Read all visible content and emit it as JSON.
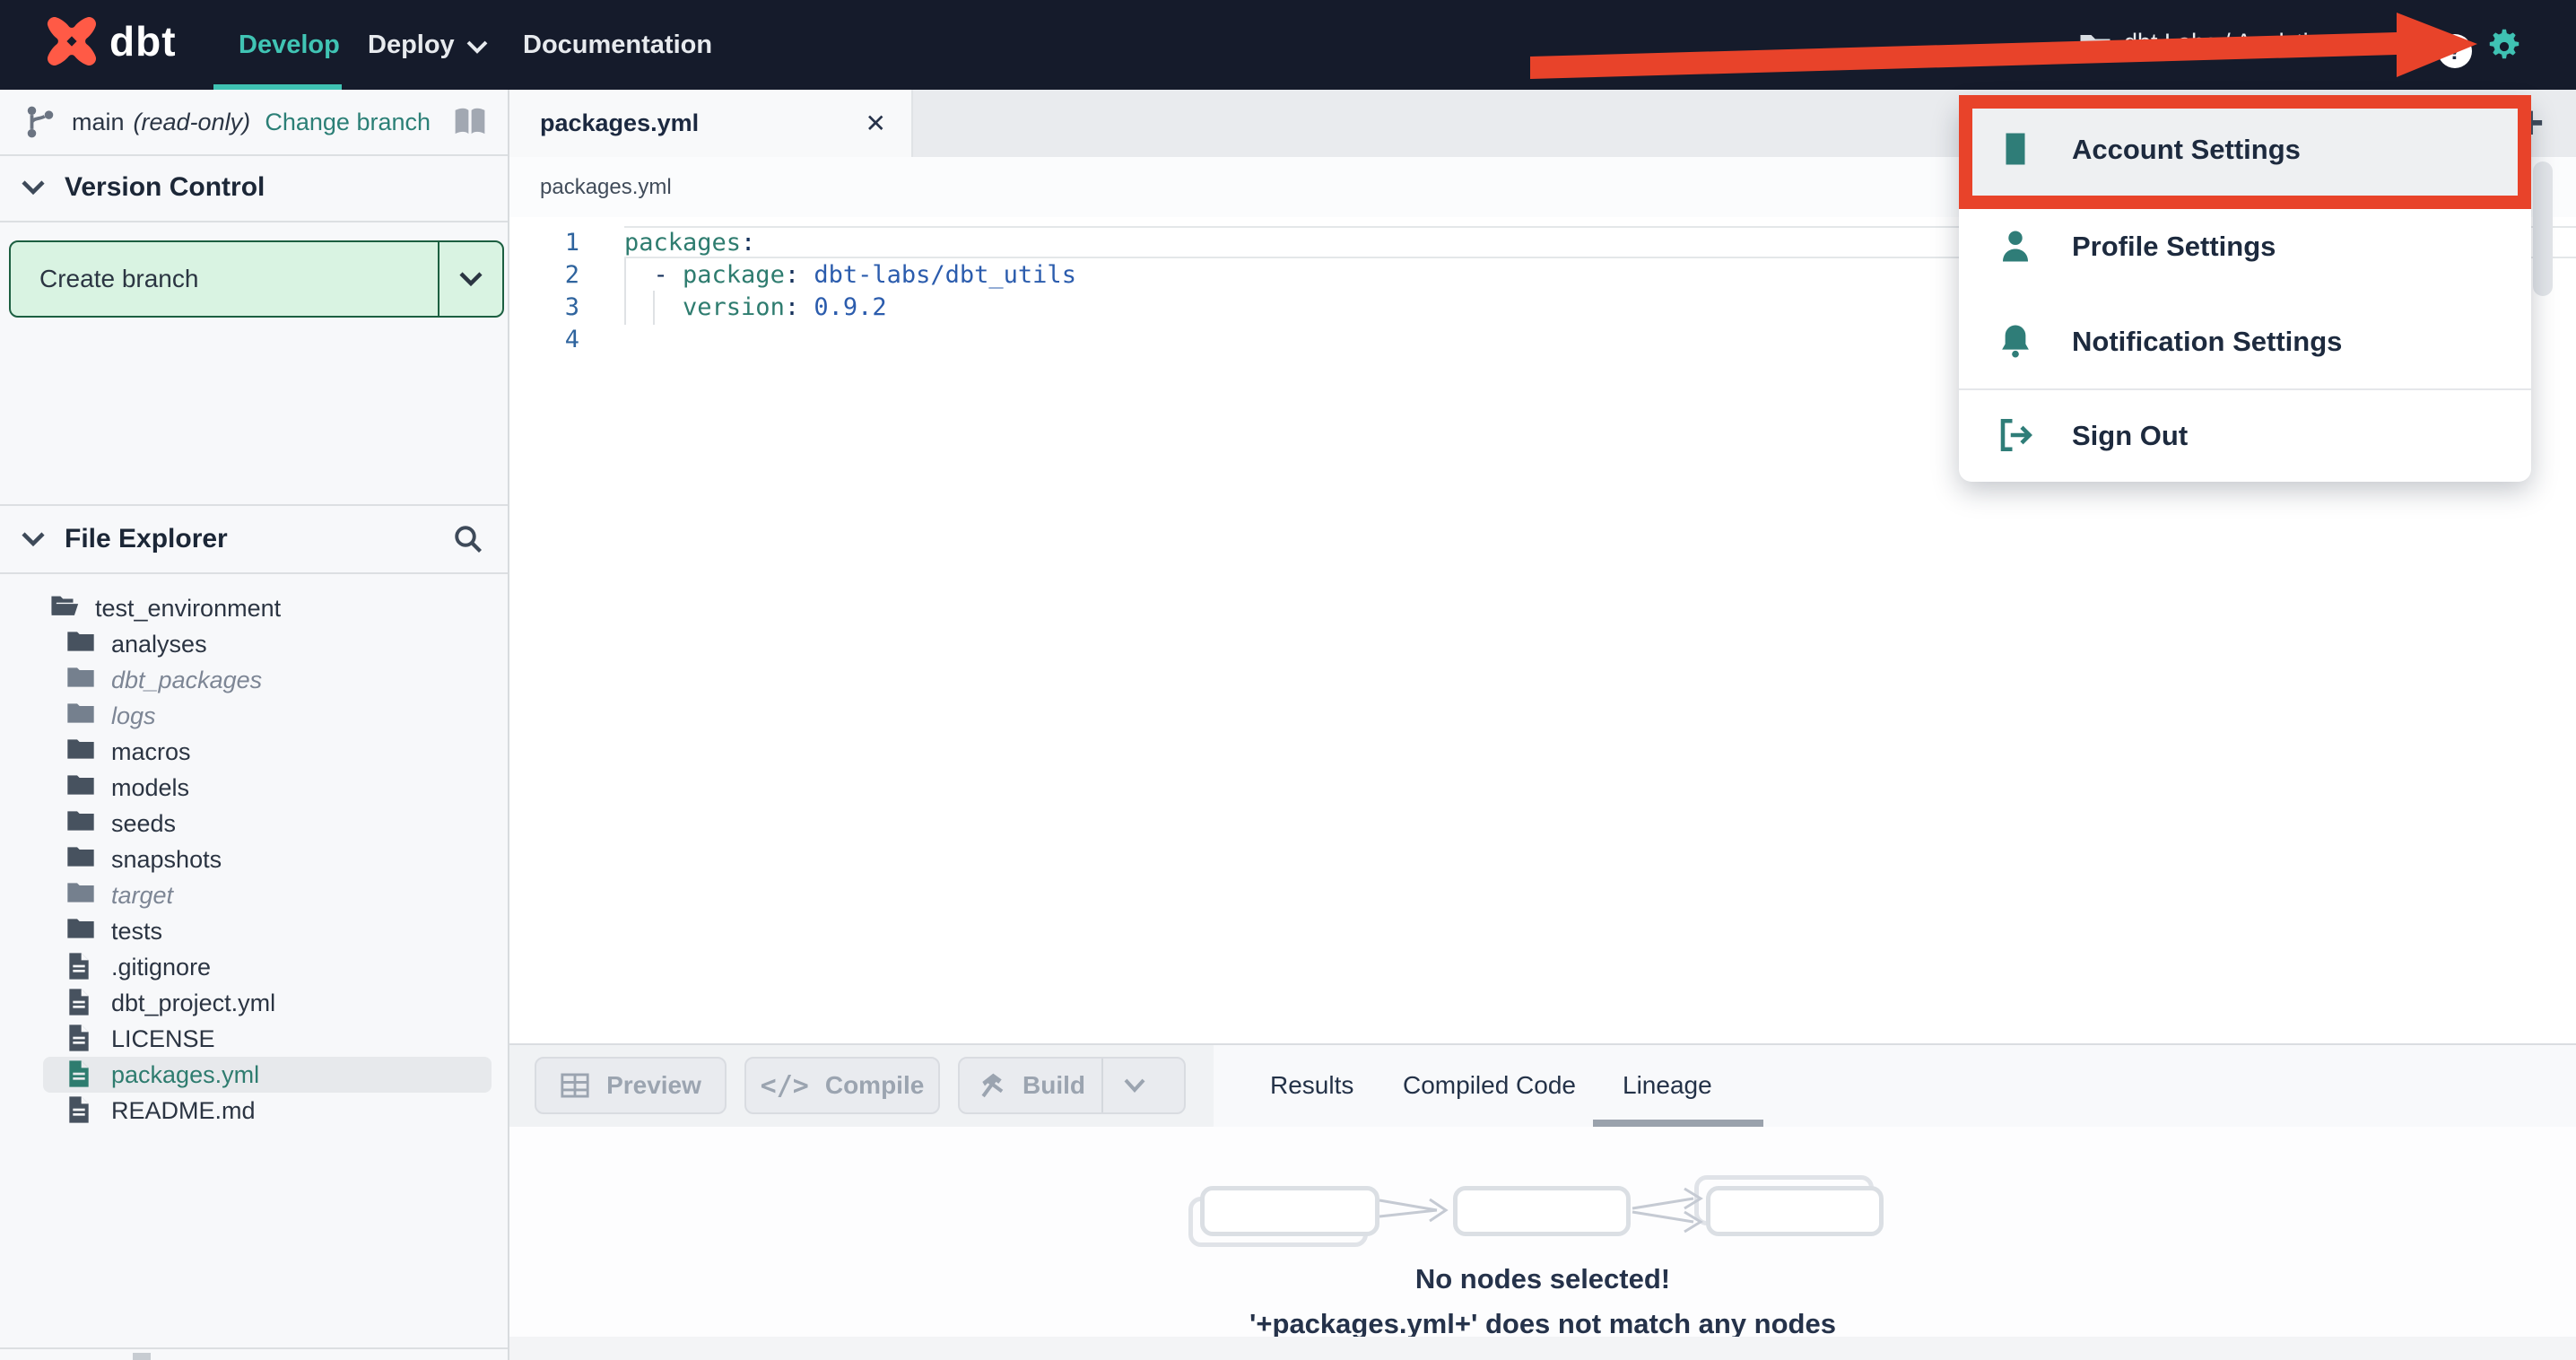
{
  "navbar": {
    "logo": "dbt",
    "items": [
      {
        "label": "Develop"
      },
      {
        "label": "Deploy"
      },
      {
        "label": "Documentation"
      }
    ],
    "project": "dbt Labs / Analytics",
    "help": "?"
  },
  "branch_bar": {
    "branch": "main",
    "mode": "(read-only)",
    "change_link": "Change branch"
  },
  "version_control": {
    "title": "Version Control",
    "create_branch": "Create branch"
  },
  "file_explorer": {
    "title": "File Explorer",
    "items": [
      {
        "label": "test_environment"
      },
      {
        "label": "analyses"
      },
      {
        "label": "dbt_packages"
      },
      {
        "label": "logs"
      },
      {
        "label": "macros"
      },
      {
        "label": "models"
      },
      {
        "label": "seeds"
      },
      {
        "label": "snapshots"
      },
      {
        "label": "target"
      },
      {
        "label": "tests"
      },
      {
        "label": ".gitignore"
      },
      {
        "label": "dbt_project.yml"
      },
      {
        "label": "LICENSE"
      },
      {
        "label": "packages.yml"
      },
      {
        "label": "README.md"
      }
    ]
  },
  "editor": {
    "tab": "packages.yml",
    "close_glyph": "✕",
    "plus_glyph": "+",
    "breadcrumb": "packages.yml"
  },
  "code": {
    "lines": [
      {
        "num": "1",
        "tokens": [
          {
            "t": "packages"
          },
          {
            "t": ":"
          }
        ]
      },
      {
        "num": "2",
        "tokens": [
          {
            "t": "  - "
          },
          {
            "t": "package"
          },
          {
            "t": ":"
          },
          {
            "t": " dbt-labs/dbt_utils"
          }
        ]
      },
      {
        "num": "3",
        "tokens": [
          {
            "t": "    "
          },
          {
            "t": "version"
          },
          {
            "t": ":"
          },
          {
            "t": " 0.9.2"
          }
        ]
      },
      {
        "num": "4",
        "tokens": []
      }
    ]
  },
  "toolbar": {
    "preview": "Preview",
    "compile": "Compile",
    "compile_glyph": "</>",
    "build": "Build"
  },
  "result_tabs": [
    {
      "label": "Results"
    },
    {
      "label": "Compiled Code"
    },
    {
      "label": "Lineage"
    }
  ],
  "lineage": {
    "msg1": "No nodes selected!",
    "msg2": "'+packages.yml+' does not match any nodes"
  },
  "menu": {
    "items": [
      {
        "label": "Account Settings"
      },
      {
        "label": "Profile Settings"
      },
      {
        "label": "Notification Settings"
      },
      {
        "label": "Sign Out"
      }
    ]
  },
  "colors": {
    "navbar_bg": "#151b2b",
    "accent_teal": "#3fc2b3",
    "link_teal": "#2b7f76",
    "annotation_red": "#e8432a",
    "logo_orange": "#ff5a46",
    "key_teal": "#2e7c6f",
    "value_blue": "#2b5cad",
    "green_button_bg": "#d9f3e2",
    "green_button_border": "#1c5f41"
  }
}
